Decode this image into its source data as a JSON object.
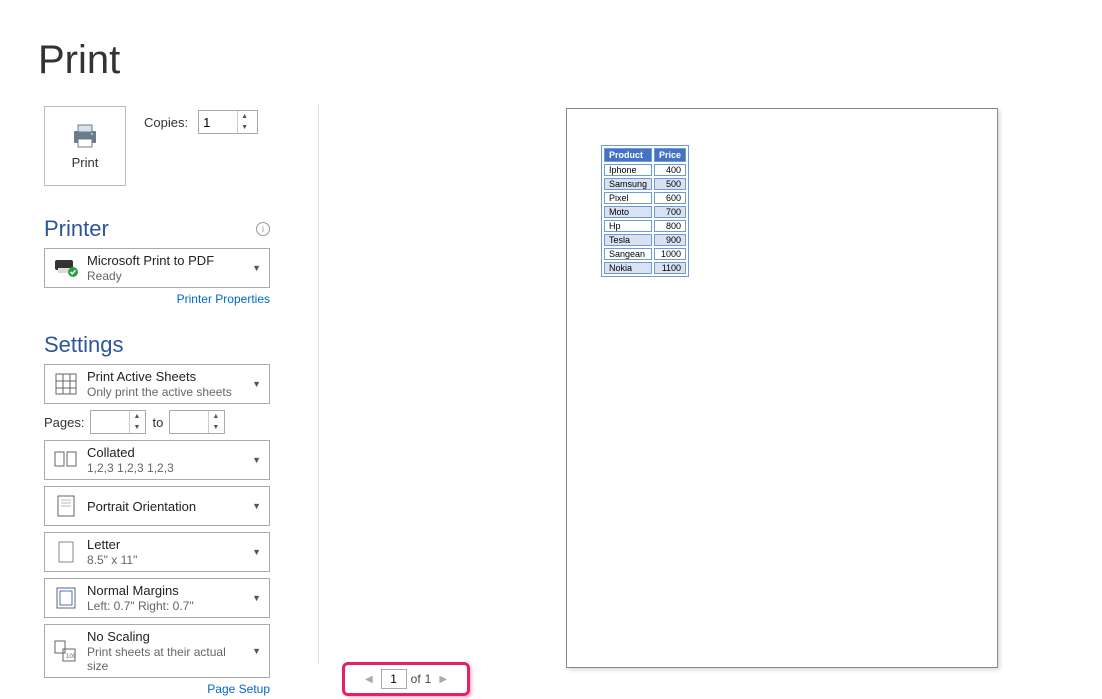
{
  "title": "Print",
  "printBtn": "Print",
  "copies": {
    "label": "Copies:",
    "value": "1"
  },
  "printer": {
    "heading": "Printer",
    "name": "Microsoft Print to PDF",
    "status": "Ready",
    "propertiesLink": "Printer Properties"
  },
  "settings": {
    "heading": "Settings",
    "what": {
      "line1": "Print Active Sheets",
      "line2": "Only print the active sheets"
    },
    "pages": {
      "label": "Pages:",
      "from": "",
      "to": "to",
      "toVal": ""
    },
    "collate": {
      "line1": "Collated",
      "line2": "1,2,3    1,2,3    1,2,3"
    },
    "orientation": "Portrait Orientation",
    "paper": {
      "line1": "Letter",
      "line2": "8.5\" x 11\""
    },
    "margins": {
      "line1": "Normal Margins",
      "line2": "Left:  0.7\"    Right:  0.7\""
    },
    "scaling": {
      "line1": "No Scaling",
      "line2": "Print sheets at their actual size"
    },
    "pageSetupLink": "Page Setup"
  },
  "previewTable": {
    "headers": [
      "Product",
      "Price"
    ],
    "rows": [
      [
        "Iphone",
        "400"
      ],
      [
        "Samsung",
        "500"
      ],
      [
        "Pixel",
        "600"
      ],
      [
        "Moto",
        "700"
      ],
      [
        "Hp",
        "800"
      ],
      [
        "Tesla",
        "900"
      ],
      [
        "Sangean",
        "1000"
      ],
      [
        "Nokia",
        "1100"
      ]
    ]
  },
  "pager": {
    "current": "1",
    "ofLabel": "of",
    "total": "1"
  }
}
